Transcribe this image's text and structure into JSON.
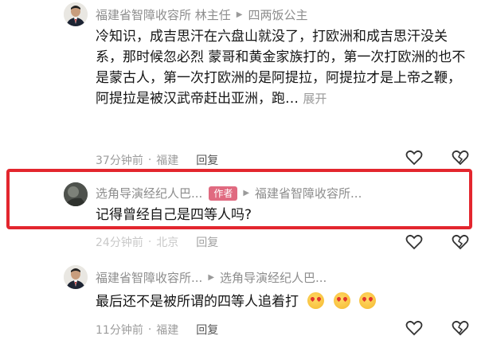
{
  "comments": [
    {
      "user": "福建省智障收容所 林主任",
      "reply_to": "四两饭公主",
      "text": "冷知识，成吉思汗在六盘山就没了，打欧洲和成吉思汗没关系，那时候忽必烈 蒙哥和黄金家族打的，第一次打欧洲的也不是蒙古人，第一次打欧洲的是阿提拉，阿提拉才是上帝之鞭，阿提拉是被汉武帝赶出亚洲，跑…",
      "expand_label": "展开",
      "time": "37分钟前",
      "location": "福建",
      "reply_label": "回复",
      "avatar_icon": "official-portrait-avatar"
    },
    {
      "user": "选角导演经纪人巴...",
      "badge": "作者",
      "reply_to": "福建省智障收容所...",
      "text": "记得曾经自己是四等人吗?",
      "time": "24分钟前",
      "location": "北京",
      "reply_label": "回复",
      "avatar_icon": "dark-photo-avatar"
    },
    {
      "user": "福建省智障收容所...",
      "reply_to": "选角导演经纪人巴...",
      "text": "最后还不是被所谓的四等人追着打",
      "time": "11分钟前",
      "location": "福建",
      "reply_label": "回复",
      "emoji": [
        "heart-eyes-emoji",
        "heart-eyes-emoji",
        "heart-eyes-emoji"
      ],
      "avatar_icon": "official-portrait-avatar"
    }
  ],
  "separator": "·",
  "icons": {
    "like": "heart-outline-icon",
    "dislike": "broken-heart-icon",
    "reply_arrow": "triangle-right-icon"
  },
  "colors": {
    "highlight_border": "#e3262e",
    "author_badge": "#e06a80",
    "meta_gray": "#8d8d8d"
  }
}
